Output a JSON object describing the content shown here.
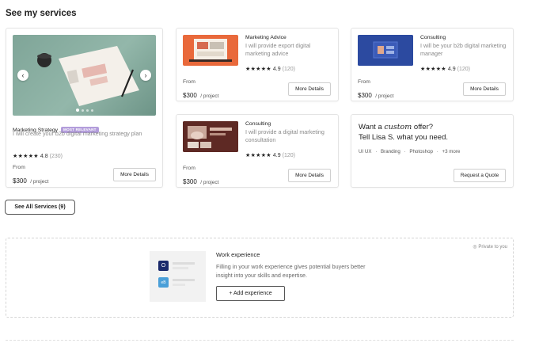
{
  "section_title": "See my services",
  "big_service": {
    "name": "Marketing Strategy",
    "badge": "MOST RELEVANT",
    "description": "I will create your b2b digital marketing strategy plan",
    "stars": "★★★★★",
    "rating": "4.8",
    "reviews": "(230)",
    "from_label": "From",
    "price": "$300",
    "per": "/ project",
    "details_label": "More Details",
    "prev_icon": "‹",
    "next_icon": "›"
  },
  "services": [
    {
      "name": "Marketing Advice",
      "description": "I will provide export digital marketing advice",
      "stars": "★★★★★",
      "rating": "4.9",
      "reviews": "(120)",
      "from_label": "From",
      "price": "$300",
      "per": "/ project",
      "details_label": "More Details"
    },
    {
      "name": "Consulting",
      "description": "I will be your b2b digital marketing manager",
      "stars": "★★★★★",
      "rating": "4.9",
      "reviews": "(120)",
      "from_label": "From",
      "price": "$300",
      "per": "/ project",
      "details_label": "More Details"
    },
    {
      "name": "Consulting",
      "description": "I will provide a digital marketing consultation",
      "stars": "★★★★★",
      "rating": "4.9",
      "reviews": "(120)",
      "from_label": "From",
      "price": "$300",
      "per": "/ project",
      "details_label": "More Details"
    }
  ],
  "offer": {
    "title_prefix": "Want a",
    "title_emph": "custom",
    "title_suffix": "offer?",
    "subtitle": "Tell Lisa S. what you need.",
    "tags": [
      "UI UX",
      "Branding",
      "Photoshop",
      "+3 more"
    ],
    "button_label": "Request a Quote"
  },
  "see_all_label": "See All Services (9)",
  "work_experience": {
    "private_label": "Private to you",
    "title": "Work experience",
    "description": "Filling in your work experience gives potential buyers better insight into your skills and expertise.",
    "button_label": "+ Add experience",
    "logo_1": "O",
    "logo_2": "eB"
  },
  "colors": {
    "badge": "#b39ddb",
    "thumb_orange": "#e9693b",
    "thumb_blue": "#2f4ea8",
    "thumb_brown": "#6a2f2a",
    "media_green": "#86ab9e",
    "logo_dark": "#1b2a6b",
    "logo_light": "#4a9fd8"
  }
}
